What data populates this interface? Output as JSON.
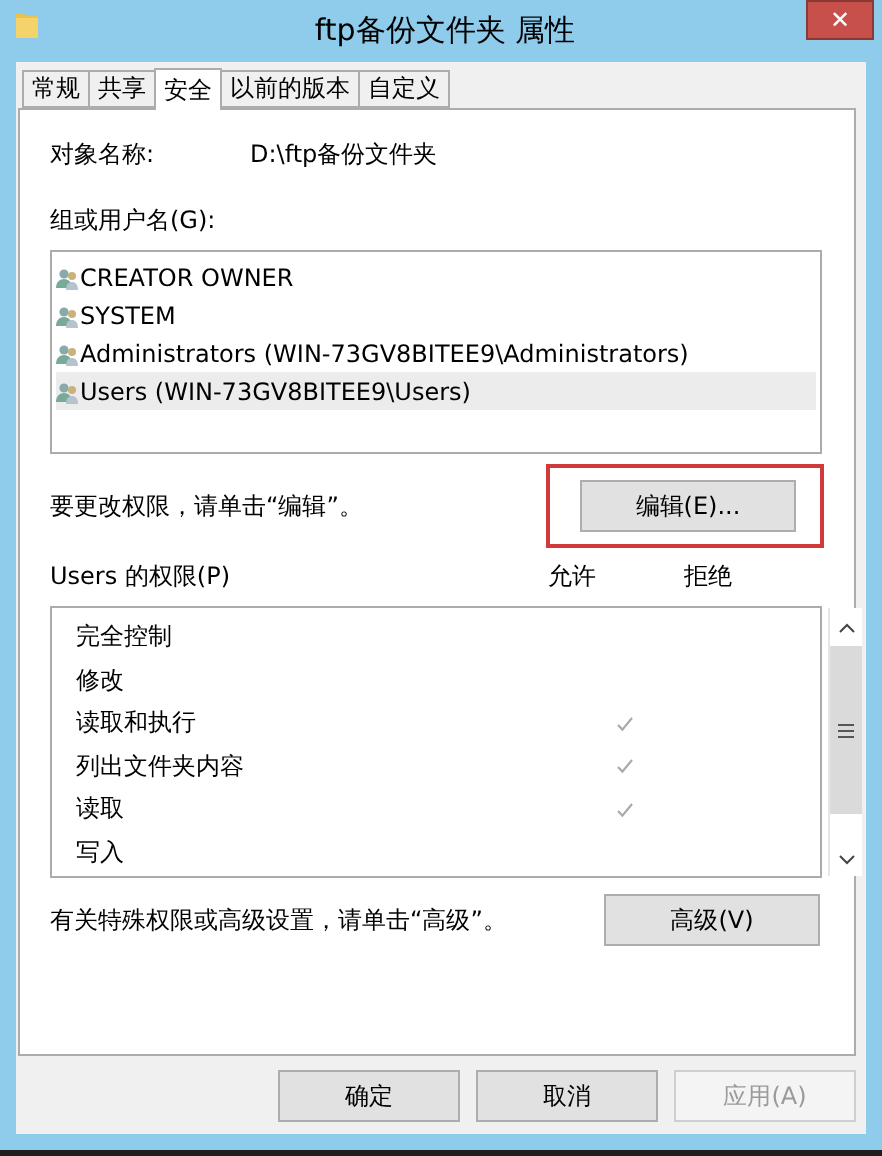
{
  "window": {
    "title": "ftp备份文件夹 属性",
    "close": "✕"
  },
  "tabs": [
    {
      "label": "常规",
      "selected": false
    },
    {
      "label": "共享",
      "selected": false
    },
    {
      "label": "安全",
      "selected": true
    },
    {
      "label": "以前的版本",
      "selected": false
    },
    {
      "label": "自定义",
      "selected": false
    }
  ],
  "object": {
    "label": "对象名称:",
    "value": "D:\\ftp备份文件夹"
  },
  "principals": {
    "label": "组或用户名(G):",
    "items": [
      {
        "name": "CREATOR OWNER",
        "selected": false
      },
      {
        "name": "SYSTEM",
        "selected": false
      },
      {
        "name": "Administrators (WIN-73GV8BITEE9\\Administrators)",
        "selected": false
      },
      {
        "name": "Users (WIN-73GV8BITEE9\\Users)",
        "selected": true
      }
    ]
  },
  "edit_hint": "要更改权限，请单击“编辑”。",
  "edit_button": {
    "label": "编辑(E)...",
    "highlighted": true
  },
  "permissions": {
    "label": "Users 的权限(P)",
    "allow_header": "允许",
    "deny_header": "拒绝",
    "rows": [
      {
        "name": "完全控制",
        "allow": false,
        "deny": false
      },
      {
        "name": "修改",
        "allow": false,
        "deny": false
      },
      {
        "name": "读取和执行",
        "allow": true,
        "deny": false
      },
      {
        "name": "列出文件夹内容",
        "allow": true,
        "deny": false
      },
      {
        "name": "读取",
        "allow": true,
        "deny": false
      },
      {
        "name": "写入",
        "allow": false,
        "deny": false
      }
    ]
  },
  "advanced_hint": "有关特殊权限或高级设置，请单击“高级”。",
  "advanced_button": "高级(V)",
  "buttons": [
    {
      "label": "确定",
      "disabled": false
    },
    {
      "label": "取消",
      "disabled": false
    },
    {
      "label": "应用(A)",
      "disabled": true
    }
  ]
}
